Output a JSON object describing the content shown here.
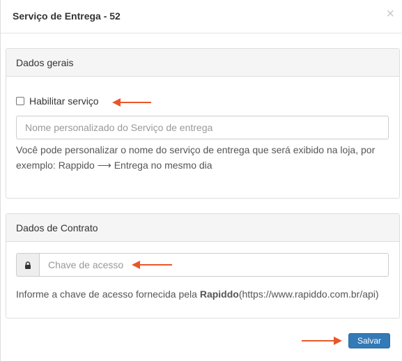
{
  "modal": {
    "title": "Serviço de Entrega - 52",
    "close_label": "×"
  },
  "general_panel": {
    "heading": "Dados gerais",
    "enable_checkbox_label": "Habilitar serviço",
    "enable_checked": false,
    "name_input": {
      "value": "",
      "placeholder": "Nome personalizado do Serviço de entrega"
    },
    "help_line1": "Você pode personalizar o nome do serviço de entrega que será exibido na loja, por",
    "help_line2": "exemplo: Rappido ⟶ Entrega no mesmo dia"
  },
  "contract_panel": {
    "heading": "Dados de Contrato",
    "access_key_input": {
      "value": "",
      "placeholder": "Chave de acesso"
    },
    "help_prefix": "Informe a chave de acesso fornecida pela ",
    "help_brand": "Rapiddo",
    "help_suffix": "(https://www.rapiddo.com.br/api)"
  },
  "footer": {
    "save_label": "Salvar"
  },
  "colors": {
    "primary": "#337ab7",
    "annotation_arrow": "#e8572a"
  }
}
